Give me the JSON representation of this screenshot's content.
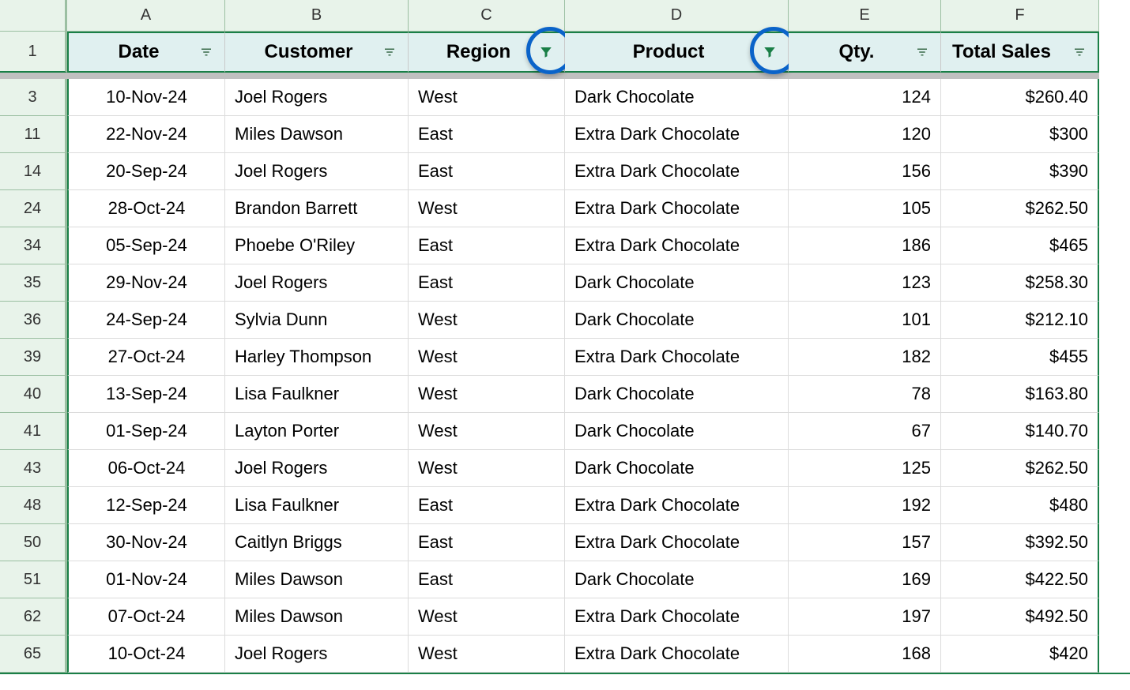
{
  "columns": {
    "letters": [
      "A",
      "B",
      "C",
      "D",
      "E",
      "F"
    ]
  },
  "headers": {
    "date": "Date",
    "customer": "Customer",
    "region": "Region",
    "product": "Product",
    "qty": "Qty.",
    "total": "Total Sales"
  },
  "header_row_number": "1",
  "filter_state": {
    "date": "unfiltered",
    "customer": "unfiltered",
    "region": "filtered",
    "product": "filtered",
    "qty": "unfiltered",
    "total": "unfiltered"
  },
  "highlight_circles": [
    "region",
    "product"
  ],
  "rows": [
    {
      "n": "3",
      "date": "10-Nov-24",
      "customer": "Joel Rogers",
      "region": "West",
      "product": "Dark Chocolate",
      "qty": "124",
      "total": "$260.40"
    },
    {
      "n": "11",
      "date": "22-Nov-24",
      "customer": "Miles Dawson",
      "region": "East",
      "product": "Extra Dark Chocolate",
      "qty": "120",
      "total": "$300"
    },
    {
      "n": "14",
      "date": "20-Sep-24",
      "customer": "Joel Rogers",
      "region": "East",
      "product": "Extra Dark Chocolate",
      "qty": "156",
      "total": "$390"
    },
    {
      "n": "24",
      "date": "28-Oct-24",
      "customer": "Brandon Barrett",
      "region": "West",
      "product": "Extra Dark Chocolate",
      "qty": "105",
      "total": "$262.50"
    },
    {
      "n": "34",
      "date": "05-Sep-24",
      "customer": "Phoebe O'Riley",
      "region": "East",
      "product": "Extra Dark Chocolate",
      "qty": "186",
      "total": "$465"
    },
    {
      "n": "35",
      "date": "29-Nov-24",
      "customer": "Joel Rogers",
      "region": "East",
      "product": "Dark Chocolate",
      "qty": "123",
      "total": "$258.30"
    },
    {
      "n": "36",
      "date": "24-Sep-24",
      "customer": "Sylvia Dunn",
      "region": "West",
      "product": "Dark Chocolate",
      "qty": "101",
      "total": "$212.10"
    },
    {
      "n": "39",
      "date": "27-Oct-24",
      "customer": "Harley Thompson",
      "region": "West",
      "product": "Extra Dark Chocolate",
      "qty": "182",
      "total": "$455"
    },
    {
      "n": "40",
      "date": "13-Sep-24",
      "customer": "Lisa Faulkner",
      "region": "West",
      "product": "Dark Chocolate",
      "qty": "78",
      "total": "$163.80"
    },
    {
      "n": "41",
      "date": "01-Sep-24",
      "customer": "Layton Porter",
      "region": "West",
      "product": "Dark Chocolate",
      "qty": "67",
      "total": "$140.70"
    },
    {
      "n": "43",
      "date": "06-Oct-24",
      "customer": "Joel Rogers",
      "region": "West",
      "product": "Dark Chocolate",
      "qty": "125",
      "total": "$262.50"
    },
    {
      "n": "48",
      "date": "12-Sep-24",
      "customer": "Lisa Faulkner",
      "region": "East",
      "product": "Extra Dark Chocolate",
      "qty": "192",
      "total": "$480"
    },
    {
      "n": "50",
      "date": "30-Nov-24",
      "customer": "Caitlyn Briggs",
      "region": "East",
      "product": "Extra Dark Chocolate",
      "qty": "157",
      "total": "$392.50"
    },
    {
      "n": "51",
      "date": "01-Nov-24",
      "customer": "Miles Dawson",
      "region": "East",
      "product": "Dark Chocolate",
      "qty": "169",
      "total": "$422.50"
    },
    {
      "n": "62",
      "date": "07-Oct-24",
      "customer": "Miles Dawson",
      "region": "West",
      "product": "Extra Dark Chocolate",
      "qty": "197",
      "total": "$492.50"
    },
    {
      "n": "65",
      "date": "10-Oct-24",
      "customer": "Joel Rogers",
      "region": "West",
      "product": "Extra Dark Chocolate",
      "qty": "168",
      "total": "$420"
    }
  ]
}
